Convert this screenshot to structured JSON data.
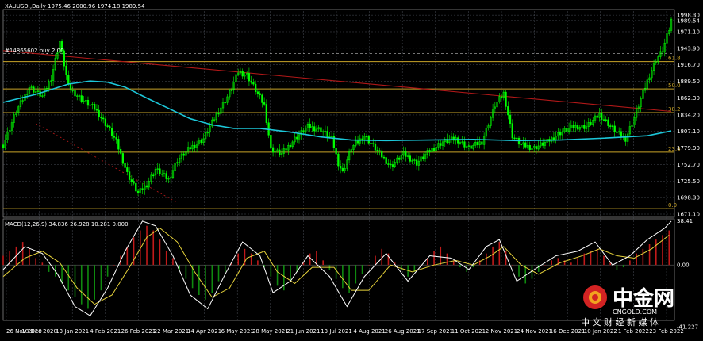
{
  "chart_data": {
    "type": "candlestick",
    "main_header": "XAUUSD.,Daily  1975.46 2000.96 1974.18 1989.54",
    "macd_header": "MACD(12,26,9) 34.836 26.928 10.281 0.000",
    "order_label": "#14865602 buy 2.00",
    "price_axis": [
      "1998.30",
      "1989.54",
      "1971.10",
      "1943.90",
      "1916.70",
      "1889.50",
      "1862.30",
      "1834.20",
      "1807.10",
      "1779.90",
      "1752.70",
      "1725.50",
      "1698.30",
      "1671.10"
    ],
    "ylim": [
      1671.1,
      2005
    ],
    "macd_axis": [
      "38.41",
      "0.00",
      "-41.227"
    ],
    "macd_ylim": [
      -48,
      40
    ],
    "x_labels": [
      "26 Nov 2020",
      "18 Dec 2020",
      "13 Jan 2021",
      "4 Feb 2021",
      "26 Feb 2021",
      "22 Mar 2021",
      "14 Apr 2021",
      "6 May 2021",
      "28 May 2021",
      "21 Jun 2021",
      "13 Jul 2021",
      "4 Aug 2021",
      "26 Aug 2021",
      "17 Sep 2021",
      "11 Oct 2021",
      "2 Nov 2021",
      "24 Nov 2021",
      "16 Dec 2021",
      "10 Jan 2022",
      "1 Feb 2022",
      "23 Feb 2022"
    ],
    "fib_levels": [
      {
        "label": "61.8",
        "price": 1922
      },
      {
        "label": "50.0",
        "price": 1877
      },
      {
        "label": "38.2",
        "price": 1838
      },
      {
        "label": "23.6",
        "price": 1773
      },
      {
        "label": "0.0",
        "price": 1680
      }
    ],
    "dashed_level": 1935,
    "close_path": [
      [
        0,
        1785
      ],
      [
        6,
        1840
      ],
      [
        12,
        1880
      ],
      [
        18,
        1865
      ],
      [
        22,
        1895
      ],
      [
        26,
        1955
      ],
      [
        30,
        1880
      ],
      [
        36,
        1860
      ],
      [
        42,
        1845
      ],
      [
        48,
        1815
      ],
      [
        52,
        1790
      ],
      [
        57,
        1738
      ],
      [
        62,
        1705
      ],
      [
        66,
        1720
      ],
      [
        70,
        1745
      ],
      [
        76,
        1728
      ],
      [
        80,
        1760
      ],
      [
        86,
        1780
      ],
      [
        92,
        1795
      ],
      [
        98,
        1835
      ],
      [
        104,
        1870
      ],
      [
        108,
        1905
      ],
      [
        112,
        1900
      ],
      [
        116,
        1875
      ],
      [
        120,
        1850
      ],
      [
        123,
        1778
      ],
      [
        128,
        1770
      ],
      [
        134,
        1795
      ],
      [
        140,
        1815
      ],
      [
        146,
        1810
      ],
      [
        151,
        1795
      ],
      [
        154,
        1755
      ],
      [
        156,
        1740
      ],
      [
        160,
        1780
      ],
      [
        166,
        1800
      ],
      [
        172,
        1775
      ],
      [
        178,
        1750
      ],
      [
        184,
        1770
      ],
      [
        190,
        1755
      ],
      [
        196,
        1775
      ],
      [
        202,
        1790
      ],
      [
        208,
        1795
      ],
      [
        214,
        1780
      ],
      [
        220,
        1790
      ],
      [
        226,
        1850
      ],
      [
        230,
        1870
      ],
      [
        234,
        1800
      ],
      [
        238,
        1785
      ],
      [
        244,
        1780
      ],
      [
        250,
        1790
      ],
      [
        256,
        1805
      ],
      [
        262,
        1815
      ],
      [
        268,
        1815
      ],
      [
        274,
        1835
      ],
      [
        278,
        1820
      ],
      [
        282,
        1805
      ],
      [
        286,
        1795
      ],
      [
        290,
        1830
      ],
      [
        294,
        1870
      ],
      [
        297,
        1900
      ],
      [
        300,
        1925
      ],
      [
        303,
        1940
      ],
      [
        306,
        1975
      ],
      [
        307,
        1990
      ]
    ],
    "close_range": [
      0,
      307
    ],
    "ma_series": [
      [
        0,
        1855
      ],
      [
        15,
        1868
      ],
      [
        30,
        1885
      ],
      [
        40,
        1890
      ],
      [
        48,
        1888
      ],
      [
        56,
        1880
      ],
      [
        66,
        1862
      ],
      [
        76,
        1845
      ],
      [
        86,
        1828
      ],
      [
        96,
        1818
      ],
      [
        106,
        1812
      ],
      [
        118,
        1812
      ],
      [
        132,
        1806
      ],
      [
        146,
        1798
      ],
      [
        160,
        1793
      ],
      [
        176,
        1792
      ],
      [
        196,
        1793
      ],
      [
        216,
        1794
      ],
      [
        236,
        1792
      ],
      [
        256,
        1793
      ],
      [
        276,
        1796
      ],
      [
        296,
        1800
      ],
      [
        307,
        1808
      ]
    ],
    "trend_line": [
      [
        0,
        1940
      ],
      [
        307,
        1840
      ]
    ],
    "trend_line2": [
      [
        15,
        1820
      ],
      [
        80,
        1690
      ]
    ],
    "macd_hist": [
      [
        0,
        8
      ],
      [
        3,
        12
      ],
      [
        6,
        16
      ],
      [
        9,
        20
      ],
      [
        12,
        14
      ],
      [
        15,
        6
      ],
      [
        18,
        2
      ],
      [
        21,
        -6
      ],
      [
        24,
        -10
      ],
      [
        27,
        -16
      ],
      [
        30,
        -22
      ],
      [
        33,
        -28
      ],
      [
        36,
        -34
      ],
      [
        39,
        -38
      ],
      [
        42,
        -30
      ],
      [
        45,
        -22
      ],
      [
        48,
        -10
      ],
      [
        51,
        0
      ],
      [
        54,
        8
      ],
      [
        57,
        16
      ],
      [
        60,
        24
      ],
      [
        63,
        30
      ],
      [
        66,
        34
      ],
      [
        69,
        30
      ],
      [
        72,
        22
      ],
      [
        75,
        12
      ],
      [
        78,
        6
      ],
      [
        81,
        -4
      ],
      [
        84,
        -12
      ],
      [
        87,
        -20
      ],
      [
        90,
        -26
      ],
      [
        93,
        -30
      ],
      [
        96,
        -24
      ],
      [
        99,
        -14
      ],
      [
        102,
        -6
      ],
      [
        105,
        2
      ],
      [
        108,
        10
      ],
      [
        111,
        14
      ],
      [
        114,
        10
      ],
      [
        117,
        4
      ],
      [
        120,
        -2
      ],
      [
        123,
        -10
      ],
      [
        126,
        -18
      ],
      [
        129,
        -22
      ],
      [
        132,
        -14
      ],
      [
        135,
        -6
      ],
      [
        138,
        2
      ],
      [
        141,
        10
      ],
      [
        144,
        12
      ],
      [
        147,
        4
      ],
      [
        150,
        -4
      ],
      [
        153,
        -12
      ],
      [
        156,
        -20
      ],
      [
        159,
        -24
      ],
      [
        162,
        -16
      ],
      [
        165,
        -8
      ],
      [
        168,
        0
      ],
      [
        171,
        8
      ],
      [
        174,
        14
      ],
      [
        177,
        10
      ],
      [
        180,
        2
      ],
      [
        183,
        -4
      ],
      [
        186,
        -10
      ],
      [
        189,
        -6
      ],
      [
        192,
        0
      ],
      [
        195,
        6
      ],
      [
        198,
        12
      ],
      [
        201,
        16
      ],
      [
        204,
        10
      ],
      [
        207,
        4
      ],
      [
        210,
        -2
      ],
      [
        213,
        -6
      ],
      [
        216,
        -2
      ],
      [
        219,
        4
      ],
      [
        222,
        10
      ],
      [
        225,
        16
      ],
      [
        228,
        20
      ],
      [
        231,
        12
      ],
      [
        234,
        0
      ],
      [
        237,
        -10
      ],
      [
        240,
        -16
      ],
      [
        243,
        -12
      ],
      [
        246,
        -6
      ],
      [
        249,
        0
      ],
      [
        252,
        4
      ],
      [
        255,
        6
      ],
      [
        258,
        4
      ],
      [
        261,
        2
      ],
      [
        264,
        6
      ],
      [
        267,
        10
      ],
      [
        270,
        12
      ],
      [
        273,
        14
      ],
      [
        276,
        8
      ],
      [
        279,
        2
      ],
      [
        282,
        -4
      ],
      [
        285,
        -2
      ],
      [
        288,
        4
      ],
      [
        291,
        10
      ],
      [
        294,
        14
      ],
      [
        297,
        18
      ],
      [
        300,
        22
      ],
      [
        303,
        26
      ],
      [
        306,
        30
      ]
    ],
    "macd_line": [
      [
        0,
        -4
      ],
      [
        10,
        16
      ],
      [
        18,
        10
      ],
      [
        25,
        -8
      ],
      [
        33,
        -36
      ],
      [
        40,
        -44
      ],
      [
        48,
        -20
      ],
      [
        56,
        12
      ],
      [
        64,
        38
      ],
      [
        70,
        34
      ],
      [
        78,
        8
      ],
      [
        86,
        -26
      ],
      [
        94,
        -38
      ],
      [
        102,
        -8
      ],
      [
        110,
        20
      ],
      [
        118,
        8
      ],
      [
        124,
        -24
      ],
      [
        132,
        -14
      ],
      [
        140,
        8
      ],
      [
        150,
        -10
      ],
      [
        158,
        -36
      ],
      [
        166,
        -10
      ],
      [
        176,
        10
      ],
      [
        186,
        -14
      ],
      [
        196,
        8
      ],
      [
        206,
        6
      ],
      [
        214,
        -4
      ],
      [
        222,
        16
      ],
      [
        228,
        22
      ],
      [
        236,
        -14
      ],
      [
        244,
        -4
      ],
      [
        254,
        8
      ],
      [
        264,
        12
      ],
      [
        272,
        20
      ],
      [
        280,
        0
      ],
      [
        288,
        8
      ],
      [
        296,
        22
      ],
      [
        304,
        32
      ],
      [
        307,
        38
      ]
    ],
    "signal_line": [
      [
        0,
        -10
      ],
      [
        10,
        6
      ],
      [
        18,
        12
      ],
      [
        26,
        2
      ],
      [
        34,
        -20
      ],
      [
        42,
        -34
      ],
      [
        50,
        -26
      ],
      [
        58,
        -2
      ],
      [
        66,
        24
      ],
      [
        72,
        32
      ],
      [
        80,
        20
      ],
      [
        88,
        -6
      ],
      [
        96,
        -28
      ],
      [
        104,
        -20
      ],
      [
        112,
        6
      ],
      [
        120,
        12
      ],
      [
        126,
        -6
      ],
      [
        134,
        -16
      ],
      [
        142,
        -2
      ],
      [
        152,
        -2
      ],
      [
        160,
        -22
      ],
      [
        168,
        -22
      ],
      [
        178,
        0
      ],
      [
        188,
        -6
      ],
      [
        198,
        0
      ],
      [
        208,
        4
      ],
      [
        216,
        0
      ],
      [
        224,
        8
      ],
      [
        230,
        16
      ],
      [
        238,
        0
      ],
      [
        246,
        -8
      ],
      [
        256,
        2
      ],
      [
        266,
        8
      ],
      [
        274,
        14
      ],
      [
        282,
        8
      ],
      [
        290,
        6
      ],
      [
        298,
        14
      ],
      [
        306,
        26
      ]
    ],
    "colors": {
      "candles": "#00ff00",
      "ma": "#1cc7d9",
      "trend": "#b01818",
      "fib": "#c9a428",
      "macd": "#ffffff",
      "signal": "#e6d23a",
      "hist_pos": "#c11a1a",
      "hist_neg": "#0f8a0f",
      "grid": "#4a4f58",
      "axis": "#b0b0b0"
    }
  },
  "watermark": {
    "brand": "中金网",
    "domain": "CNGOLD.COM",
    "tagline": "中 文 财 经 新 媒 体"
  }
}
